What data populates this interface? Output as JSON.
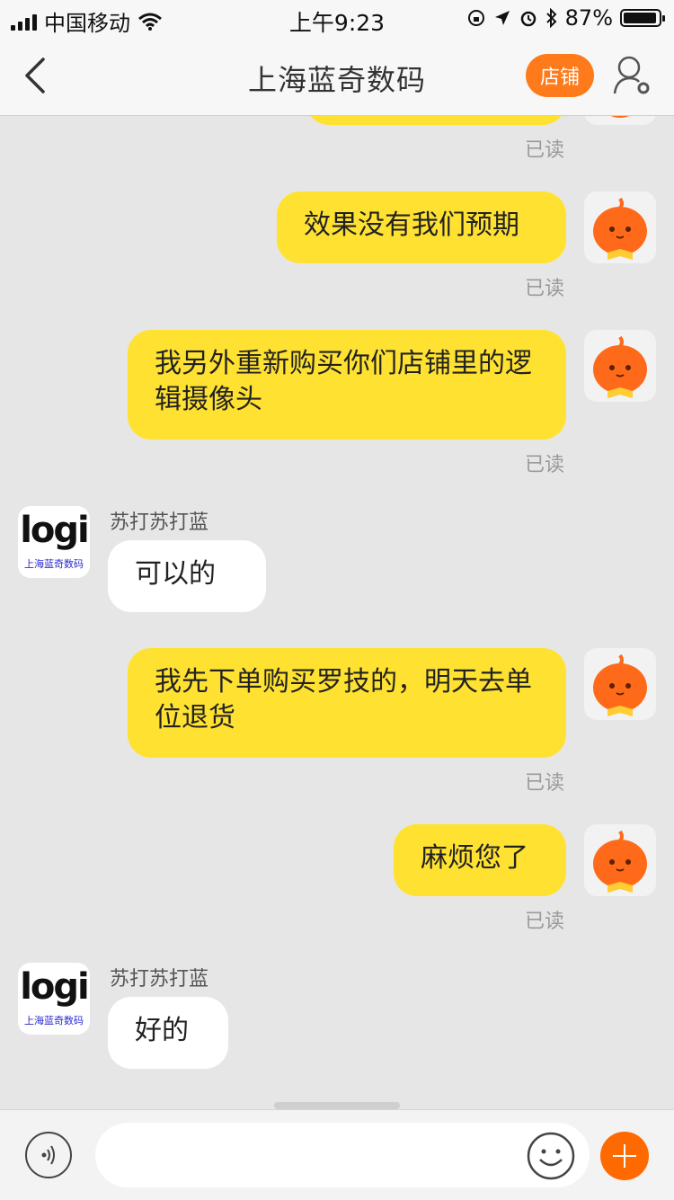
{
  "status_bar": {
    "carrier": "中国移动",
    "time": "上午9:23",
    "battery": "87%",
    "battery_level": 0.87
  },
  "nav": {
    "title": "上海蓝奇数码",
    "shop_button": "店铺"
  },
  "chat": {
    "read_label": "已读",
    "messages": [
      {
        "from": "me",
        "text": "效果没有我们预期"
      },
      {
        "from": "me",
        "text": "我另外重新购买你们店铺里的逻辑摄像头"
      },
      {
        "from": "them",
        "sender": "苏打苏打蓝",
        "text": "可以的"
      },
      {
        "from": "me",
        "text": "我先下单购买罗技的，明天去单位退货"
      },
      {
        "from": "me",
        "text": "麻烦您了"
      },
      {
        "from": "them",
        "sender": "苏打苏打蓝",
        "text": "好的"
      }
    ],
    "them_avatar": {
      "logo_text": "logi",
      "caption": "上海蓝奇数码"
    }
  },
  "colors": {
    "my_bubble": "#ffe231",
    "their_bubble": "#ffffff",
    "accent": "#ff7a1a"
  },
  "icons": [
    "back-chevron-icon",
    "person-settings-icon",
    "wifi-icon",
    "signal-icon",
    "voice-icon",
    "emoji-icon",
    "plus-icon"
  ]
}
